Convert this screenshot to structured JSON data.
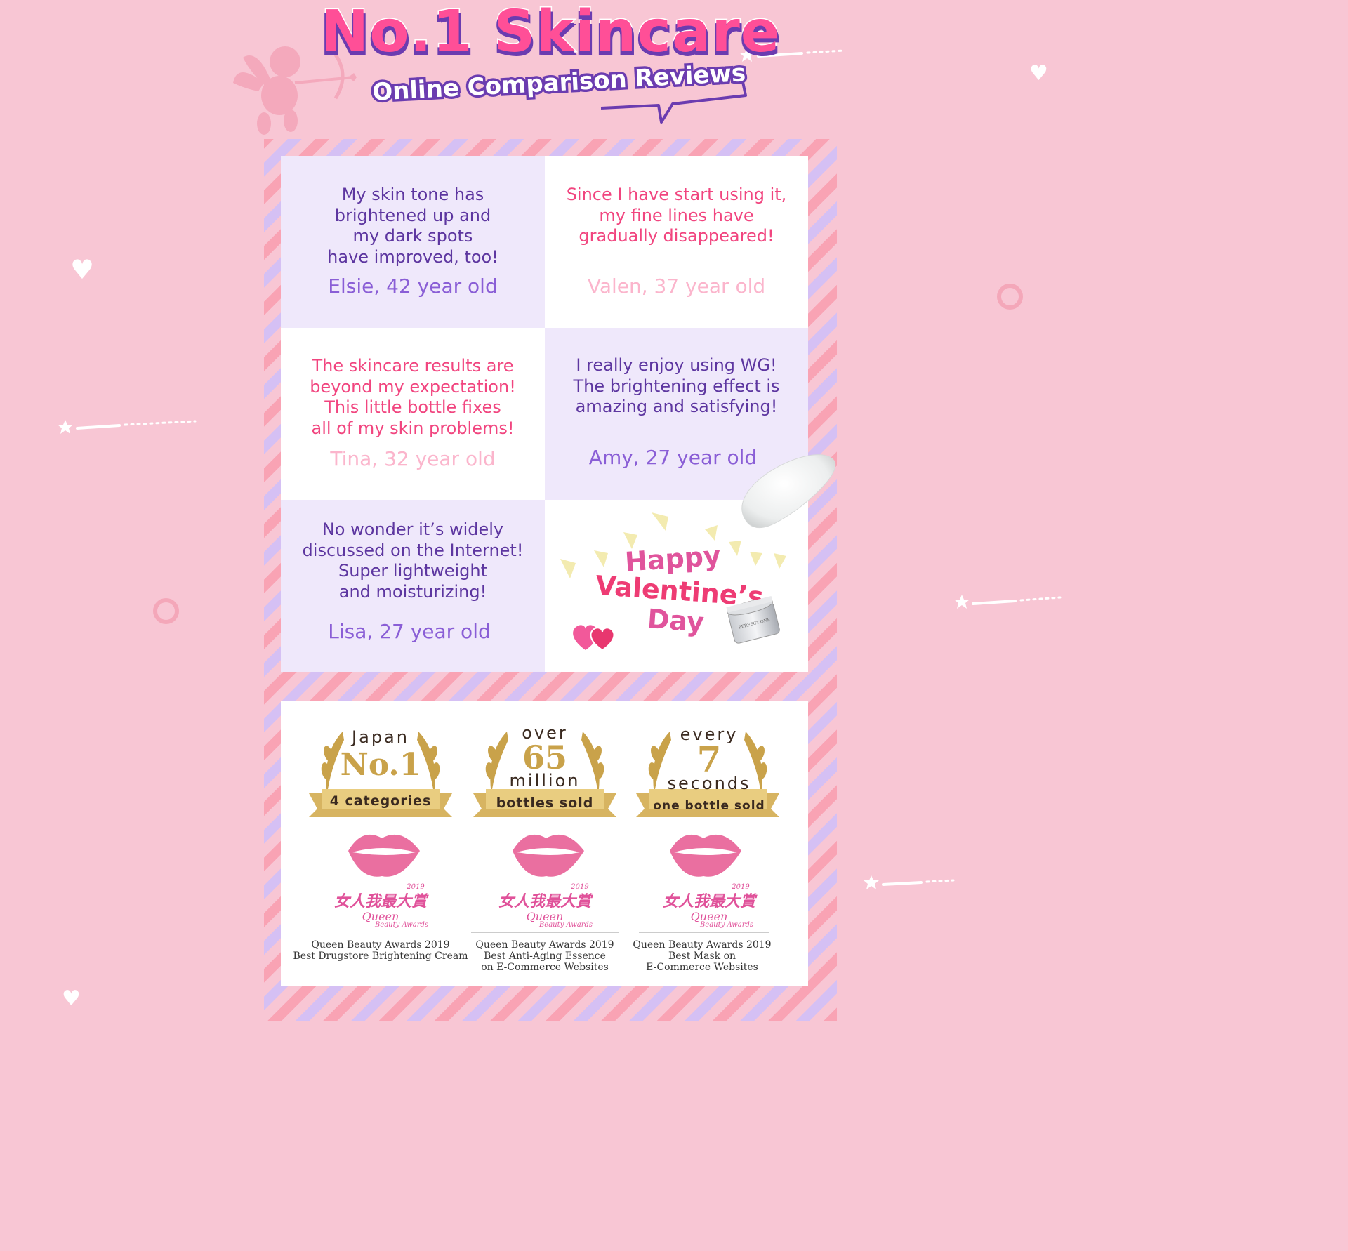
{
  "header": {
    "title": "No.1 Skincare",
    "subtitle": "Online Comparison Reviews"
  },
  "reviews": [
    {
      "quote": [
        "My skin tone has",
        "brightened up and",
        "my dark spots",
        "have improved, too!"
      ],
      "author": "Elsie, 42 year old"
    },
    {
      "quote": [
        "Since I have start using it,",
        "my fine lines have",
        "gradually disappeared!"
      ],
      "author": "Valen, 37 year old"
    },
    {
      "quote": [
        "The skincare results are",
        "beyond my expectation!",
        "This little bottle fixes",
        "all of my skin problems!"
      ],
      "author": "Tina, 32 year old"
    },
    {
      "quote": [
        "I really enjoy using WG!",
        "The brightening effect is",
        "amazing and satisfying!"
      ],
      "author": "Amy, 27 year old"
    },
    {
      "quote": [
        "No wonder it’s widely",
        "discussed on the Internet!",
        "Super lightweight",
        "and moisturizing!"
      ],
      "author": "Lisa, 27 year old"
    }
  ],
  "valentine": {
    "line1": "Happy",
    "line2": "Valentine’s",
    "line3": "Day",
    "jar_label": "PERFECT ONE"
  },
  "awards": [
    {
      "top": "Japan",
      "big": "No.1",
      "ribbon": "4 categories",
      "qb_year": "2019",
      "qb_cn": "女人我最大賞",
      "qb_en": "Queen",
      "qb_en2": "Beauty Awards",
      "caption": [
        "Queen Beauty Awards 2019",
        "Best Drugstore Brightening Cream"
      ]
    },
    {
      "top": "over",
      "big": "65",
      "mid": "million",
      "ribbon": "bottles sold",
      "qb_year": "2019",
      "qb_cn": "女人我最大賞",
      "qb_en": "Queen",
      "qb_en2": "Beauty Awards",
      "caption": [
        "Queen Beauty Awards 2019",
        "Best Anti-Aging Essence",
        "on E-Commerce Websites"
      ]
    },
    {
      "top": "every",
      "big": "7",
      "mid": "seconds",
      "ribbon": "one bottle sold",
      "qb_year": "2019",
      "qb_cn": "女人我最大賞",
      "qb_en": "Queen",
      "qb_en2": "Beauty Awards",
      "caption": [
        "Queen Beauty Awards 2019",
        "Best Mask on",
        "E-Commerce Websites"
      ]
    }
  ],
  "colors": {
    "background": "#f8c6d4",
    "title_pink": "#ff4f97",
    "title_purple": "#6b3cb0",
    "gold": "#c9a24a"
  }
}
